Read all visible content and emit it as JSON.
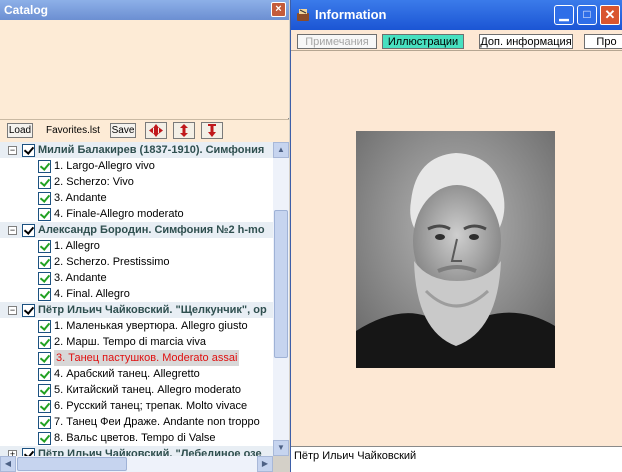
{
  "catalog": {
    "title": "Catalog",
    "toolbar": {
      "load": "Load",
      "file": "Favorites.lst",
      "save": "Save"
    },
    "tree": [
      {
        "type": "group",
        "expander": "⊟",
        "text": "Милий Балакирев (1837-1910). Симфония"
      },
      {
        "type": "item",
        "text": "1. Largo-Allegro vivo"
      },
      {
        "type": "item",
        "text": "2. Scherzo: Vivo"
      },
      {
        "type": "item",
        "text": "3. Andante"
      },
      {
        "type": "item",
        "text": "4. Finale-Allegro moderato"
      },
      {
        "type": "group",
        "expander": "⊟",
        "text": "Александр Бородин. Симфония №2 h-mo"
      },
      {
        "type": "item",
        "text": "1. Allegro"
      },
      {
        "type": "item",
        "text": "2. Scherzo. Prestissimo"
      },
      {
        "type": "item",
        "text": "3. Andante"
      },
      {
        "type": "item",
        "text": "4. Final. Allegro"
      },
      {
        "type": "group",
        "expander": "⊟",
        "text": "Пётр Ильич Чайковский. \"Щелкунчик\", ор"
      },
      {
        "type": "item",
        "text": "1. Маленькая увертюра. Allegro giusto"
      },
      {
        "type": "item",
        "text": "2. Марш. Tempo di marcia viva"
      },
      {
        "type": "item",
        "text": "3. Танец пастушков. Moderato assai",
        "selected": true
      },
      {
        "type": "item",
        "text": "4. Арабский танец. Allegretto"
      },
      {
        "type": "item",
        "text": "5. Китайский танец. Allegro moderato"
      },
      {
        "type": "item",
        "text": "6. Русский танец; трепак. Molto vivace"
      },
      {
        "type": "item",
        "text": "7. Танец Феи Драже. Andante non troppo"
      },
      {
        "type": "item",
        "text": "8. Вальс цветов. Tempo di Valse"
      },
      {
        "type": "group",
        "expander": "⊞",
        "text": "Пётр Ильич Чайковский. \"Лебединое озе"
      }
    ]
  },
  "info": {
    "title": "Information",
    "tabs": [
      {
        "label": "Примечания",
        "state": "dim"
      },
      {
        "label": "Иллюстрации",
        "state": "active"
      },
      {
        "label": "Доп. информация",
        "state": "normal"
      },
      {
        "label": "Про",
        "state": "normal"
      }
    ],
    "caption": "Пётр Ильич Чайковский"
  },
  "colors": {
    "catalog_titlebar": "#7a9de0",
    "info_titlebar": "#1b55d4",
    "panel_bg": "#fdebd6",
    "active_tab": "#48e0c0",
    "selected_text": "#e01010"
  },
  "icons": [
    "close-icon",
    "minimize-icon",
    "maximize-icon",
    "app-icon",
    "move-both-icon",
    "move-vertical-icon",
    "move-down-icon",
    "scroll-up-icon",
    "scroll-down-icon",
    "scroll-left-icon",
    "scroll-right-icon"
  ]
}
